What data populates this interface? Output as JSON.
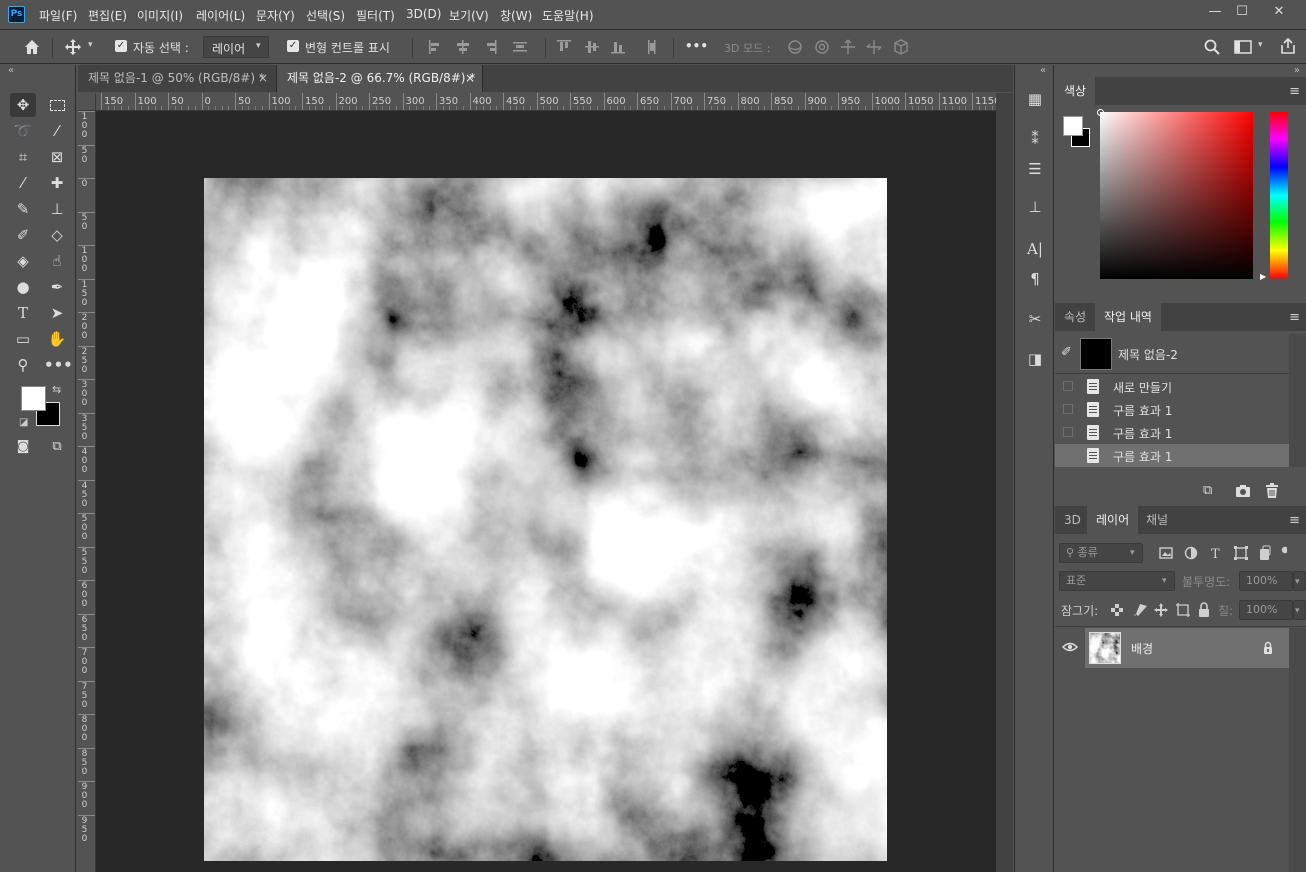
{
  "app": {
    "logo": "Ps"
  },
  "menu": [
    "파일(F)",
    "편집(E)",
    "이미지(I)",
    "레이어(L)",
    "문자(Y)",
    "선택(S)",
    "필터(T)",
    "3D(D)",
    "보기(V)",
    "창(W)",
    "도움말(H)"
  ],
  "window_controls": {
    "minimize": "—",
    "maximize": "☐",
    "close": "✕"
  },
  "options": {
    "auto_select_label": "자동 선택 :",
    "auto_select_value": "레이어",
    "transform_label": "변형 컨트롤 표시",
    "more": "•••",
    "mode_3d": "3D 모드 :"
  },
  "tabs": [
    {
      "label": "제목 없음-1 @ 50% (RGB/8#) *",
      "close": "×"
    },
    {
      "label": "제목 없음-2 @ 66.7% (RGB/8#) *",
      "close": "×"
    }
  ],
  "ruler": {
    "h": [
      "150",
      "100",
      "50",
      "0",
      "50",
      "100",
      "150",
      "200",
      "250",
      "300",
      "350",
      "400",
      "450",
      "500",
      "550",
      "600",
      "650",
      "700",
      "750",
      "800",
      "850",
      "900",
      "950",
      "1000",
      "1050",
      "1100",
      "1150"
    ],
    "v": [
      "100",
      "50",
      "0",
      "50",
      "100",
      "150",
      "200",
      "250",
      "300",
      "350",
      "400",
      "450",
      "500",
      "550",
      "600",
      "650",
      "700",
      "750",
      "800",
      "850",
      "900",
      "950"
    ]
  },
  "colors": {
    "foreground": "#ffffff",
    "background": "#000000",
    "hue_cursor": "#ff0000"
  },
  "color_panel": {
    "tab": "색상"
  },
  "history_panel": {
    "tabs": [
      "속성",
      "작업 내역"
    ],
    "snapshot": "제목 없음-2",
    "items": [
      "새로 만들기",
      "구름 효과 1",
      "구름 효과 1",
      "구름 효과 1"
    ]
  },
  "layers_panel": {
    "tabs": [
      "3D",
      "레이어",
      "채널"
    ],
    "filter": "종류",
    "blend_mode": "표준",
    "opacity_label": "불투명도:",
    "opacity_value": "100%",
    "lock_label": "잠그기:",
    "fill_label": "칠:",
    "fill_value": "100%",
    "layer_name": "배경"
  },
  "icons": {
    "toolbox": [
      "move-tool-icon",
      "marquee-tool-icon",
      "lasso-tool-icon",
      "magic-wand-icon",
      "crop-tool-icon",
      "frame-tool-icon",
      "eyedropper-icon",
      "healing-brush-icon",
      "brush-icon",
      "clone-stamp-icon",
      "history-brush-icon",
      "eraser-icon",
      "paint-bucket-icon",
      "smudge-icon",
      "dodge-icon",
      "pen-tool-icon",
      "type-tool-icon",
      "path-select-icon",
      "rectangle-tool-icon",
      "hand-tool-icon",
      "zoom-tool-icon",
      "more-tools-icon"
    ]
  }
}
